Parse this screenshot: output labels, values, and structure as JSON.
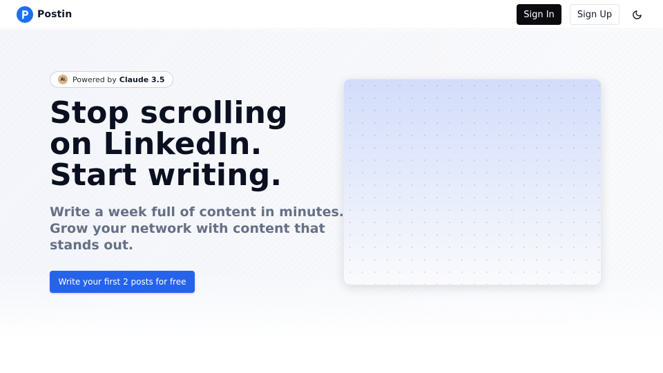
{
  "header": {
    "brand_name": "Postin",
    "signin_label": "Sign In",
    "signup_label": "Sign Up",
    "theme_toggle_icon": "moon-icon",
    "logo_icon": "postin-logo-icon"
  },
  "hero": {
    "badge": {
      "icon": "anthropic-logo-icon",
      "icon_text": "A\\",
      "prefix": "Powered by",
      "model": "Claude 3.5"
    },
    "headline": [
      "Stop scrolling",
      "on LinkedIn.",
      "Start writing."
    ],
    "subheadline": [
      "Write a week full of content in minutes.",
      "Grow your network with content that",
      "stands out."
    ],
    "cta_label": "Write your first 2 posts for free"
  },
  "colors": {
    "brand_blue": "#2563eb",
    "signin_bg": "#0b0b0f",
    "headline_text": "#0b1020",
    "subheadline_text": "#667085"
  }
}
